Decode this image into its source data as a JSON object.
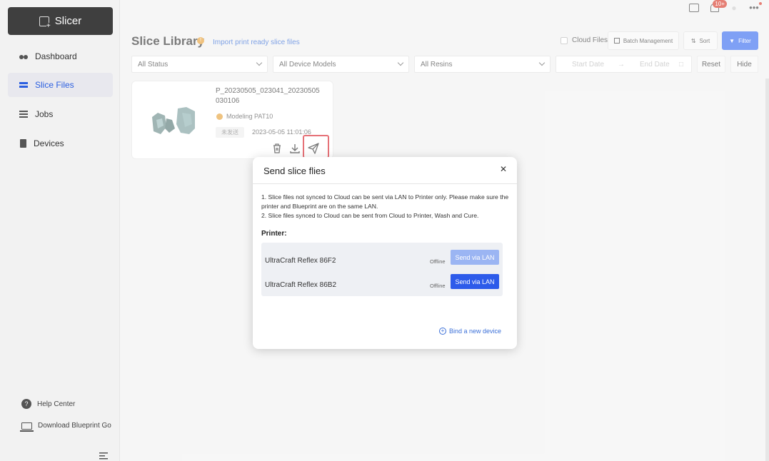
{
  "app": {
    "name": "Slicer"
  },
  "sidebar": {
    "items": [
      {
        "label": "Dashboard",
        "icon": "dashboard-icon",
        "active": false
      },
      {
        "label": "Slice Files",
        "icon": "layers-icon",
        "active": true
      },
      {
        "label": "Jobs",
        "icon": "jobs-icon",
        "active": false
      },
      {
        "label": "Devices",
        "icon": "device-icon",
        "active": false
      }
    ],
    "help": "Help Center",
    "download": "Download Blueprint Go"
  },
  "topbar": {
    "notification_badge": "10+"
  },
  "header": {
    "title": "Slice Library",
    "import_link": "Import print ready slice files",
    "cloud_files": "Cloud Files",
    "batch_management": "Batch Management",
    "sort": "Sort",
    "filter": "Filter"
  },
  "filters": {
    "status": "All Status",
    "device_models": "All Device Models",
    "resins": "All Resins",
    "start_date": "Start Date",
    "end_date": "End Date",
    "reset": "Reset",
    "hide": "Hide"
  },
  "card": {
    "file_name": "P_20230505_023041_20230505030106",
    "resin": "Modeling PAT10",
    "status_tag": "未发送",
    "date": "2023-05-05 11:01:06"
  },
  "dialog": {
    "title": "Send slice flies",
    "note_1": "1. Slice files not synced to Cloud can be sent via LAN to Printer only. Please make sure the printer and Blueprint are on the same LAN.",
    "note_2": "2. Slice files synced to Cloud can be sent from Cloud to Printer, Wash and Cure.",
    "printer_label": "Printer:",
    "printers": [
      {
        "name": "UltraCraft Reflex 86F2",
        "status": "Offline",
        "button": "Send via LAN",
        "enabled": false
      },
      {
        "name": "UltraCraft Reflex 86B2",
        "status": "Offline",
        "button": "Send via LAN",
        "enabled": true
      }
    ],
    "bind_link": "Bind a new device"
  },
  "colors": {
    "accent": "#2d5bea",
    "highlight": "#d9252f",
    "sidebar_button": "#3f3f3f"
  }
}
